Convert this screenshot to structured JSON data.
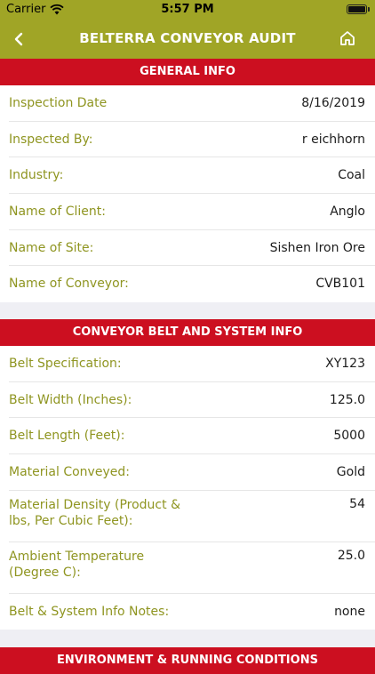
{
  "status_bar": {
    "carrier": "Carrier",
    "time": "5:57 PM",
    "icons": [
      "wifi-icon",
      "battery-icon"
    ]
  },
  "nav": {
    "title": "BELTERRA CONVEYOR AUDIT",
    "back_icon": "chevron-left-icon",
    "home_icon": "home-icon"
  },
  "colors": {
    "brand": "#a0a526",
    "section_header": "#cc0f20",
    "label": "#8f9521"
  },
  "sections": {
    "general": {
      "header": "GENERAL INFO",
      "rows": [
        {
          "label": "Inspection Date",
          "value": "8/16/2019"
        },
        {
          "label": "Inspected By:",
          "value": "r eichhorn"
        },
        {
          "label": "Industry:",
          "value": "Coal"
        },
        {
          "label": "Name of Client:",
          "value": "Anglo"
        },
        {
          "label": "Name of Site:",
          "value": "Sishen Iron Ore"
        },
        {
          "label": "Name of Conveyor:",
          "value": "CVB101"
        }
      ]
    },
    "belt": {
      "header": "CONVEYOR BELT AND SYSTEM INFO",
      "rows": [
        {
          "label": "Belt Specification:",
          "value": "XY123"
        },
        {
          "label": "Belt Width (Inches):",
          "value": "125.0"
        },
        {
          "label": "Belt Length (Feet):",
          "value": "5000"
        },
        {
          "label": "Material Conveyed:",
          "value": "Gold"
        },
        {
          "label": "Material Density (Product & lbs, Per Cubic Feet):",
          "value": "54"
        },
        {
          "label": "Ambient Temperature (Degree C):",
          "value": "25.0"
        },
        {
          "label": "Belt & System Info Notes:",
          "value": "none"
        }
      ]
    },
    "environment": {
      "header": "ENVIRONMENT & RUNNING CONDITIONS"
    }
  }
}
